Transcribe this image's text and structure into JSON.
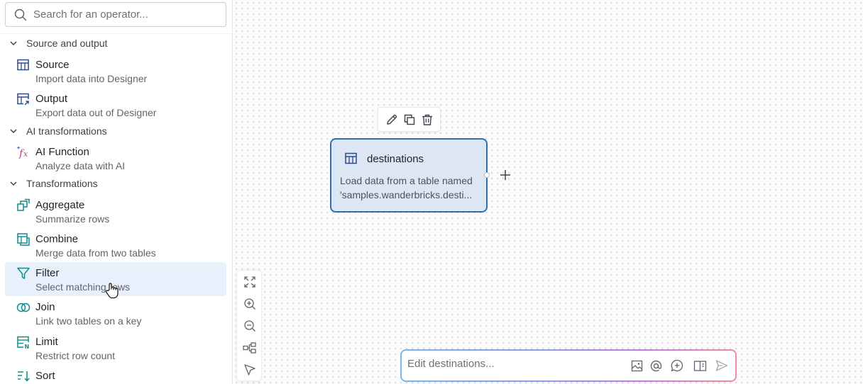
{
  "search": {
    "placeholder": "Search for an operator..."
  },
  "sections": [
    {
      "label": "Source and output"
    },
    {
      "label": "AI transformations"
    },
    {
      "label": "Transformations"
    }
  ],
  "operators": [
    {
      "title": "Source",
      "description": "Import data into Designer",
      "icon": "table-icon"
    },
    {
      "title": "Output",
      "description": "Export data out of Designer",
      "icon": "output-icon"
    },
    {
      "title": "AI Function",
      "description": "Analyze data with AI",
      "icon": "ai-function-icon"
    },
    {
      "title": "Aggregate",
      "description": "Summarize rows",
      "icon": "aggregate-icon"
    },
    {
      "title": "Combine",
      "description": "Merge data from two tables",
      "icon": "combine-icon"
    },
    {
      "title": "Filter",
      "description": "Select matching rows",
      "icon": "filter-icon"
    },
    {
      "title": "Join",
      "description": "Link two tables on a key",
      "icon": "join-icon"
    },
    {
      "title": "Limit",
      "description": "Restrict row count",
      "icon": "limit-icon"
    },
    {
      "title": "Sort",
      "description": "",
      "icon": "sort-icon"
    }
  ],
  "node": {
    "title": "destinations",
    "description_line1": "Load data from a table named",
    "description_line2": "'samples.wanderbricks.desti..."
  },
  "chat": {
    "placeholder": "Edit destinations..."
  },
  "colors": {
    "accent": "#2f6fb4",
    "node_fill": "#dde7f3",
    "active_row": "#e8f1fb",
    "icon_blue": "#2c4a86",
    "icon_teal": "#0e8c8c",
    "ai_pink": "#d6337a"
  }
}
